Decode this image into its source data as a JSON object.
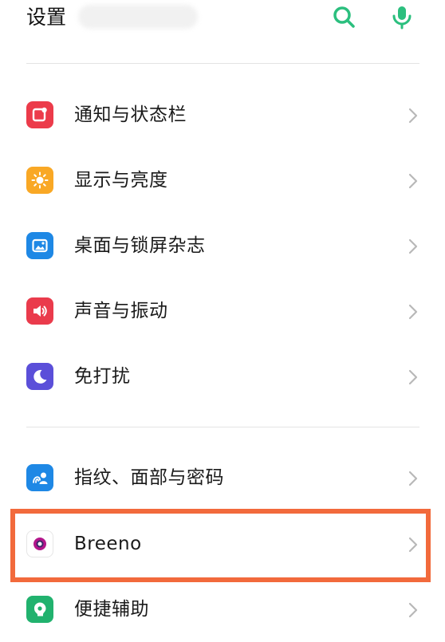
{
  "header": {
    "title": "设置",
    "search_icon": "search-icon",
    "mic_icon": "microphone-icon"
  },
  "colors": {
    "accent": "#2bbf7e",
    "highlight": "#f26a3c"
  },
  "settings": {
    "items": [
      {
        "label": "通知与状态栏",
        "icon": "notification-icon",
        "color": "#ec3b4a"
      },
      {
        "label": "显示与亮度",
        "icon": "sun-icon",
        "color": "#f9a825"
      },
      {
        "label": "桌面与锁屏杂志",
        "icon": "wallpaper-icon",
        "color": "#1e88e5"
      },
      {
        "label": "声音与振动",
        "icon": "speaker-icon",
        "color": "#ea3b4c"
      },
      {
        "label": "免打扰",
        "icon": "moon-icon",
        "color": "#5b4fd9"
      },
      {
        "label": "指纹、面部与密码",
        "icon": "fingerprint-face-icon",
        "color": "#1e88e5"
      },
      {
        "label": "Breeno",
        "icon": "breeno-icon",
        "color": "#b3168b"
      },
      {
        "label": "便捷辅助",
        "icon": "accessibility-icon",
        "color": "#21b26e"
      }
    ]
  }
}
